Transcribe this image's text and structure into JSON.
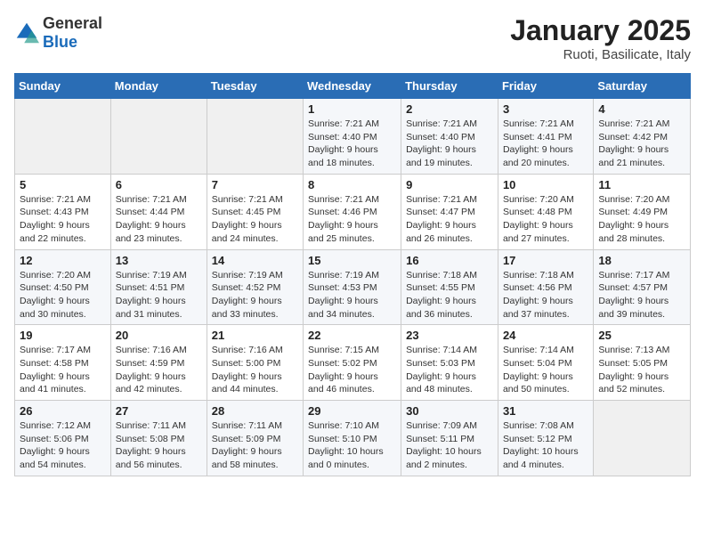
{
  "header": {
    "logo_general": "General",
    "logo_blue": "Blue",
    "month": "January 2025",
    "location": "Ruoti, Basilicate, Italy"
  },
  "weekdays": [
    "Sunday",
    "Monday",
    "Tuesday",
    "Wednesday",
    "Thursday",
    "Friday",
    "Saturday"
  ],
  "weeks": [
    [
      {
        "day": "",
        "info": ""
      },
      {
        "day": "",
        "info": ""
      },
      {
        "day": "",
        "info": ""
      },
      {
        "day": "1",
        "info": "Sunrise: 7:21 AM\nSunset: 4:40 PM\nDaylight: 9 hours\nand 18 minutes."
      },
      {
        "day": "2",
        "info": "Sunrise: 7:21 AM\nSunset: 4:40 PM\nDaylight: 9 hours\nand 19 minutes."
      },
      {
        "day": "3",
        "info": "Sunrise: 7:21 AM\nSunset: 4:41 PM\nDaylight: 9 hours\nand 20 minutes."
      },
      {
        "day": "4",
        "info": "Sunrise: 7:21 AM\nSunset: 4:42 PM\nDaylight: 9 hours\nand 21 minutes."
      }
    ],
    [
      {
        "day": "5",
        "info": "Sunrise: 7:21 AM\nSunset: 4:43 PM\nDaylight: 9 hours\nand 22 minutes."
      },
      {
        "day": "6",
        "info": "Sunrise: 7:21 AM\nSunset: 4:44 PM\nDaylight: 9 hours\nand 23 minutes."
      },
      {
        "day": "7",
        "info": "Sunrise: 7:21 AM\nSunset: 4:45 PM\nDaylight: 9 hours\nand 24 minutes."
      },
      {
        "day": "8",
        "info": "Sunrise: 7:21 AM\nSunset: 4:46 PM\nDaylight: 9 hours\nand 25 minutes."
      },
      {
        "day": "9",
        "info": "Sunrise: 7:21 AM\nSunset: 4:47 PM\nDaylight: 9 hours\nand 26 minutes."
      },
      {
        "day": "10",
        "info": "Sunrise: 7:20 AM\nSunset: 4:48 PM\nDaylight: 9 hours\nand 27 minutes."
      },
      {
        "day": "11",
        "info": "Sunrise: 7:20 AM\nSunset: 4:49 PM\nDaylight: 9 hours\nand 28 minutes."
      }
    ],
    [
      {
        "day": "12",
        "info": "Sunrise: 7:20 AM\nSunset: 4:50 PM\nDaylight: 9 hours\nand 30 minutes."
      },
      {
        "day": "13",
        "info": "Sunrise: 7:19 AM\nSunset: 4:51 PM\nDaylight: 9 hours\nand 31 minutes."
      },
      {
        "day": "14",
        "info": "Sunrise: 7:19 AM\nSunset: 4:52 PM\nDaylight: 9 hours\nand 33 minutes."
      },
      {
        "day": "15",
        "info": "Sunrise: 7:19 AM\nSunset: 4:53 PM\nDaylight: 9 hours\nand 34 minutes."
      },
      {
        "day": "16",
        "info": "Sunrise: 7:18 AM\nSunset: 4:55 PM\nDaylight: 9 hours\nand 36 minutes."
      },
      {
        "day": "17",
        "info": "Sunrise: 7:18 AM\nSunset: 4:56 PM\nDaylight: 9 hours\nand 37 minutes."
      },
      {
        "day": "18",
        "info": "Sunrise: 7:17 AM\nSunset: 4:57 PM\nDaylight: 9 hours\nand 39 minutes."
      }
    ],
    [
      {
        "day": "19",
        "info": "Sunrise: 7:17 AM\nSunset: 4:58 PM\nDaylight: 9 hours\nand 41 minutes."
      },
      {
        "day": "20",
        "info": "Sunrise: 7:16 AM\nSunset: 4:59 PM\nDaylight: 9 hours\nand 42 minutes."
      },
      {
        "day": "21",
        "info": "Sunrise: 7:16 AM\nSunset: 5:00 PM\nDaylight: 9 hours\nand 44 minutes."
      },
      {
        "day": "22",
        "info": "Sunrise: 7:15 AM\nSunset: 5:02 PM\nDaylight: 9 hours\nand 46 minutes."
      },
      {
        "day": "23",
        "info": "Sunrise: 7:14 AM\nSunset: 5:03 PM\nDaylight: 9 hours\nand 48 minutes."
      },
      {
        "day": "24",
        "info": "Sunrise: 7:14 AM\nSunset: 5:04 PM\nDaylight: 9 hours\nand 50 minutes."
      },
      {
        "day": "25",
        "info": "Sunrise: 7:13 AM\nSunset: 5:05 PM\nDaylight: 9 hours\nand 52 minutes."
      }
    ],
    [
      {
        "day": "26",
        "info": "Sunrise: 7:12 AM\nSunset: 5:06 PM\nDaylight: 9 hours\nand 54 minutes."
      },
      {
        "day": "27",
        "info": "Sunrise: 7:11 AM\nSunset: 5:08 PM\nDaylight: 9 hours\nand 56 minutes."
      },
      {
        "day": "28",
        "info": "Sunrise: 7:11 AM\nSunset: 5:09 PM\nDaylight: 9 hours\nand 58 minutes."
      },
      {
        "day": "29",
        "info": "Sunrise: 7:10 AM\nSunset: 5:10 PM\nDaylight: 10 hours\nand 0 minutes."
      },
      {
        "day": "30",
        "info": "Sunrise: 7:09 AM\nSunset: 5:11 PM\nDaylight: 10 hours\nand 2 minutes."
      },
      {
        "day": "31",
        "info": "Sunrise: 7:08 AM\nSunset: 5:12 PM\nDaylight: 10 hours\nand 4 minutes."
      },
      {
        "day": "",
        "info": ""
      }
    ]
  ]
}
